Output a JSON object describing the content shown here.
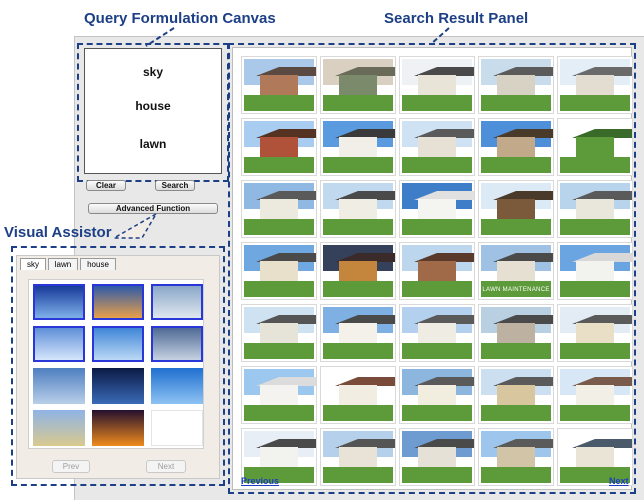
{
  "callouts": {
    "query_canvas": "Query Formulation Canvas",
    "result_panel": "Search Result Panel",
    "visual_assistor": "Visual Assistor"
  },
  "canvas": {
    "words": [
      "sky",
      "house",
      "lawn"
    ]
  },
  "buttons": {
    "clear": "Clear",
    "search": "Search",
    "advanced": "Advanced Function"
  },
  "assistor": {
    "tabs": [
      "sky",
      "lawn",
      "house"
    ],
    "active_tab": "sky",
    "thumbnails": [
      {
        "selected": true,
        "top": "#173a99",
        "bottom": "#7fb0ea",
        "icon": "sun-sky"
      },
      {
        "selected": true,
        "top": "#2e5aa8",
        "bottom": "#e9a04a",
        "icon": "sunset-sky"
      },
      {
        "selected": true,
        "top": "#8aa7c8",
        "bottom": "#dfe7ef",
        "icon": "cloud-sky"
      },
      {
        "selected": true,
        "top": "#5f8fd8",
        "bottom": "#d6e6fb",
        "icon": "cloud-sky"
      },
      {
        "selected": true,
        "top": "#3f86d6",
        "bottom": "#bcd9f6",
        "icon": "blue-sky"
      },
      {
        "selected": true,
        "top": "#4f6a95",
        "bottom": "#c6d2e2",
        "icon": "storm-sky"
      },
      {
        "selected": false,
        "top": "#4e7fc0",
        "bottom": "#b9cfe9",
        "icon": "wispy-sky"
      },
      {
        "selected": false,
        "top": "#0b1a44",
        "bottom": "#3a6bb8",
        "icon": "night-sky"
      },
      {
        "selected": false,
        "top": "#1f6fd0",
        "bottom": "#8ec3f3",
        "icon": "clear-sky"
      },
      {
        "selected": false,
        "top": "#8fb4e6",
        "bottom": "#d9c98e",
        "icon": "temple-sky"
      },
      {
        "selected": false,
        "top": "#23102f",
        "bottom": "#f08b1d",
        "icon": "sunset-sky"
      },
      {
        "selected": false,
        "top": "#ffffff",
        "bottom": "#ffffff",
        "icon": "empty"
      }
    ],
    "prev": "Prev",
    "next": "Next"
  },
  "results": {
    "images": [
      {
        "sky": "#a9c8ea",
        "house": "#b07a5a",
        "roof": "#5a4a42"
      },
      {
        "sky": "#d9d0c2",
        "house": "#7b8a6b",
        "roof": "#6a6a58"
      },
      {
        "sky": "#eef2f5",
        "house": "#e9e4d8",
        "roof": "#4a4a4a"
      },
      {
        "sky": "#c9dcec",
        "house": "#d8d2c4",
        "roof": "#5b5b5b"
      },
      {
        "sky": "#e4eef6",
        "house": "#e2ddd0",
        "roof": "#6a6a6a"
      },
      {
        "sky": "#a8cdf0",
        "house": "#b0523a",
        "roof": "#553322"
      },
      {
        "sky": "#5a9be0",
        "house": "#f1efe8",
        "roof": "#3a3a3a"
      },
      {
        "sky": "#cfe2f3",
        "house": "#e6e1d4",
        "roof": "#5a5a5a"
      },
      {
        "sky": "#4e8fda",
        "house": "#c2a98a",
        "roof": "#4a3a2a"
      },
      {
        "sky": "#ffffff",
        "house": "#5d9a3a",
        "roof": "#3a6a2a"
      },
      {
        "sky": "#8fb9e2",
        "house": "#ece9df",
        "roof": "#5a5a5a"
      },
      {
        "sky": "#c1d9ef",
        "house": "#f0ede4",
        "roof": "#4a4a4a"
      },
      {
        "sky": "#3e7ec9",
        "house": "#f4f4f0",
        "roof": "#e0e0e0"
      },
      {
        "sky": "#dceaf6",
        "house": "#7a5a3a",
        "roof": "#4a3a2a"
      },
      {
        "sky": "#b8d3ec",
        "house": "#e9e6dc",
        "roof": "#5a5a5a"
      },
      {
        "sky": "#6fa8e0",
        "house": "#e9e0cc",
        "roof": "#4a4a4a"
      },
      {
        "sky": "#35405a",
        "house": "#c4863d",
        "roof": "#3a2a2a"
      },
      {
        "sky": "#bcd6ee",
        "house": "#a06a48",
        "roof": "#5a3a2a"
      },
      {
        "sky": "#9ec1e4",
        "house": "#e6e0d2",
        "roof": "#4a4a4a",
        "caption": "LAWN MAINTENANCE"
      },
      {
        "sky": "#6aa5e2",
        "house": "#f2f2ee",
        "roof": "#d8d8d8"
      },
      {
        "sky": "#cfe2f1",
        "house": "#e6e3d9",
        "roof": "#555"
      },
      {
        "sky": "#7fb0e3",
        "house": "#f3f1ea",
        "roof": "#4a4a4a"
      },
      {
        "sky": "#b3d1ee",
        "house": "#efece4",
        "roof": "#5a5a5a"
      },
      {
        "sky": "#b9cfe2",
        "house": "#bdb1a2",
        "roof": "#4a4a4a"
      },
      {
        "sky": "#e3ecf5",
        "house": "#e8dfc6",
        "roof": "#5a5a5a"
      },
      {
        "sky": "#9cc7ee",
        "house": "#f4f3ef",
        "roof": "#dcdcdc"
      },
      {
        "sky": "#ffffff",
        "house": "#f1ede3",
        "roof": "#7a4a3a"
      },
      {
        "sky": "#8db6de",
        "house": "#f1eddf",
        "roof": "#5a5a5a"
      },
      {
        "sky": "#cbdff1",
        "house": "#d8c79e",
        "roof": "#5a5a5a"
      },
      {
        "sky": "#d8e7f5",
        "house": "#f2efe6",
        "roof": "#7a5a4a"
      },
      {
        "sky": "#e7eef5",
        "house": "#f2f2ef",
        "roof": "#4a4a4a"
      },
      {
        "sky": "#b5d0ea",
        "house": "#e8e3d6",
        "roof": "#555"
      },
      {
        "sky": "#6e9bd0",
        "house": "#e6e1d6",
        "roof": "#4a4a4a"
      },
      {
        "sky": "#9ec6ec",
        "house": "#d2c4a6",
        "roof": "#5a5a5a"
      },
      {
        "sky": "#ffffff",
        "house": "#e9e4d6",
        "roof": "#4a5a6a"
      }
    ],
    "previous": "Previous",
    "next": "Next"
  }
}
